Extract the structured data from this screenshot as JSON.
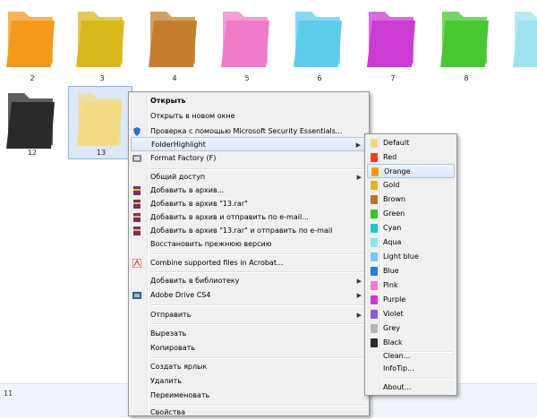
{
  "folders": [
    {
      "label": "2",
      "color": "#f39a1e"
    },
    {
      "label": "3",
      "color": "#d9b81d"
    },
    {
      "label": "4",
      "color": "#c57d2f"
    },
    {
      "label": "5",
      "color": "#f07cc9"
    },
    {
      "label": "6",
      "color": "#5ccce9"
    },
    {
      "label": "7",
      "color": "#cc3bd3"
    },
    {
      "label": "8",
      "color": "#47c832"
    },
    {
      "label": "",
      "color": "#9fe3ef"
    },
    {
      "label": "12",
      "color": "#2a2a2a"
    },
    {
      "label": "13",
      "color": "#f3db86"
    }
  ],
  "status": {
    "text": "11"
  },
  "context_menu": {
    "items": [
      {
        "label": "Открыть"
      },
      {
        "label": "Открыть в новом окне"
      },
      {
        "label": "Проверка с помощью Microsoft Security Essentials..."
      },
      {
        "label": "FolderHighlight"
      },
      {
        "label": "Format Factory (F)"
      },
      {
        "label": "Общий доступ"
      },
      {
        "label": "Добавить в архив..."
      },
      {
        "label": "Добавить в архив \"13.rar\""
      },
      {
        "label": "Добавить в архив и отправить по e-mail..."
      },
      {
        "label": "Добавить в архив \"13.rar\" и отправить по e-mail"
      },
      {
        "label": "Восстановить прежнюю версию"
      },
      {
        "label": "Combine supported files in Acrobat..."
      },
      {
        "label": "Добавить в библиотеку"
      },
      {
        "label": "Adobe Drive CS4"
      },
      {
        "label": "Отправить"
      },
      {
        "label": "Вырезать"
      },
      {
        "label": "Копировать"
      },
      {
        "label": "Создать ярлык"
      },
      {
        "label": "Удалить"
      },
      {
        "label": "Переименовать"
      },
      {
        "label": "Свойства"
      }
    ]
  },
  "submenu": {
    "items": [
      {
        "label": "Default",
        "color": "#f2d98a"
      },
      {
        "label": "Red",
        "color": "#e8412a"
      },
      {
        "label": "Orange",
        "color": "#f39a1e"
      },
      {
        "label": "Gold",
        "color": "#d9b81d"
      },
      {
        "label": "Brown",
        "color": "#b6742e"
      },
      {
        "label": "Green",
        "color": "#3fbf2e"
      },
      {
        "label": "Cyan",
        "color": "#1fc7c8"
      },
      {
        "label": "Aqua",
        "color": "#8fe6e6"
      },
      {
        "label": "Light blue",
        "color": "#7ec4f0"
      },
      {
        "label": "Blue",
        "color": "#2c7be0"
      },
      {
        "label": "Pink",
        "color": "#f07cc9"
      },
      {
        "label": "Purple",
        "color": "#cc3bd3"
      },
      {
        "label": "Violet",
        "color": "#8a5ad6"
      },
      {
        "label": "Grey",
        "color": "#b4b4b4"
      },
      {
        "label": "Black",
        "color": "#2a2a2a"
      },
      {
        "label": "Clean..."
      },
      {
        "label": "InfoTip..."
      },
      {
        "label": "About..."
      }
    ]
  }
}
